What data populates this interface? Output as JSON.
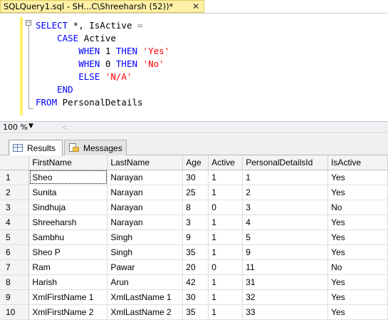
{
  "tab": {
    "title": "SQLQuery1.sql - SH...C\\Shreeharsh (52))*",
    "close_glyph": "✕"
  },
  "editor": {
    "collapse_glyph": "−",
    "lines": [
      {
        "kw1": "SELECT",
        "plain1": " *, IsActive ",
        "op1": "="
      },
      {
        "kw1": "CASE",
        "plain1": " Active"
      },
      {
        "kw1": "WHEN",
        "plain1": " 1 ",
        "kw2": "THEN",
        "str1": "'Yes'"
      },
      {
        "kw1": "WHEN",
        "plain1": " 0 ",
        "kw2": "THEN",
        "str1": "'No'"
      },
      {
        "kw1": "ELSE",
        "str1": "'N/A'"
      },
      {
        "kw1": "END"
      },
      {
        "kw1": "FROM",
        "plain1": " PersonalDetails"
      }
    ]
  },
  "zoom": {
    "value": "100 %",
    "dropdown_glyph": "▼",
    "scroll_left_glyph": "<"
  },
  "results_tabs": {
    "results_label": "Results",
    "messages_label": "Messages"
  },
  "grid": {
    "columns": [
      "",
      "FirstName",
      "LastName",
      "Age",
      "Active",
      "PersonalDetailsId",
      "IsActive"
    ],
    "rows": [
      [
        "1",
        "Sheo",
        "Narayan",
        "30",
        "1",
        "1",
        "Yes"
      ],
      [
        "2",
        "Sunita",
        "Narayan",
        "25",
        "1",
        "2",
        "Yes"
      ],
      [
        "3",
        "Sindhuja",
        "Narayan",
        "8",
        "0",
        "3",
        "No"
      ],
      [
        "4",
        "Shreeharsh",
        "Narayan",
        "3",
        "1",
        "4",
        "Yes"
      ],
      [
        "5",
        "Sambhu",
        "Singh",
        "9",
        "1",
        "5",
        "Yes"
      ],
      [
        "6",
        "Sheo P",
        "Singh",
        "35",
        "1",
        "9",
        "Yes"
      ],
      [
        "7",
        "Ram",
        "Pawar",
        "20",
        "0",
        "11",
        "No"
      ],
      [
        "8",
        "Harish",
        "Arun",
        "42",
        "1",
        "31",
        "Yes"
      ],
      [
        "9",
        "XmlFirstName 1",
        "XmlLastName 1",
        "30",
        "1",
        "32",
        "Yes"
      ],
      [
        "10",
        "XmlFirstName 2",
        "XmlLastName 2",
        "35",
        "1",
        "33",
        "Yes"
      ]
    ]
  }
}
